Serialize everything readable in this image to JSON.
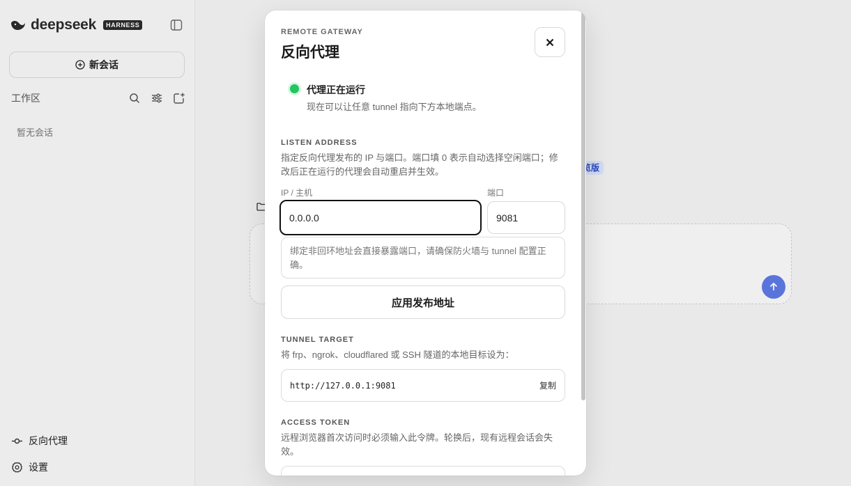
{
  "sidebar": {
    "brand": "deepseek",
    "brand_badge": "HARNESS",
    "new_chat_label": "新会话",
    "workspace_label": "工作区",
    "empty_label": "暂无会话",
    "reverse_proxy_label": "反向代理",
    "settings_label": "设置"
  },
  "background": {
    "chip_label": "览版"
  },
  "modal": {
    "eyebrow": "REMOTE GATEWAY",
    "title": "反向代理",
    "status": {
      "title": "代理正在运行",
      "description": "现在可以让任意 tunnel 指向下方本地端点。",
      "color": "#22c55e"
    },
    "listen": {
      "heading": "LISTEN ADDRESS",
      "description": "指定反向代理发布的 IP 与端口。端口填 0 表示自动选择空闲端口；修改后正在运行的代理会自动重启并生效。",
      "ip_label": "IP / 主机",
      "ip_value": "0.0.0.0",
      "port_label": "端口",
      "port_value": "9081",
      "warning": "绑定非回环地址会直接暴露端口，请确保防火墙与 tunnel 配置正确。",
      "apply_label": "应用发布地址"
    },
    "tunnel": {
      "heading": "TUNNEL TARGET",
      "description": "将 frp、ngrok、cloudflared 或 SSH 隧道的本地目标设为：",
      "url": "http://127.0.0.1:9081",
      "copy_label": "复制"
    },
    "token": {
      "heading": "ACCESS TOKEN",
      "description": "远程浏览器首次访问时必须输入此令牌。轮换后，现有远程会话会失效。"
    }
  }
}
